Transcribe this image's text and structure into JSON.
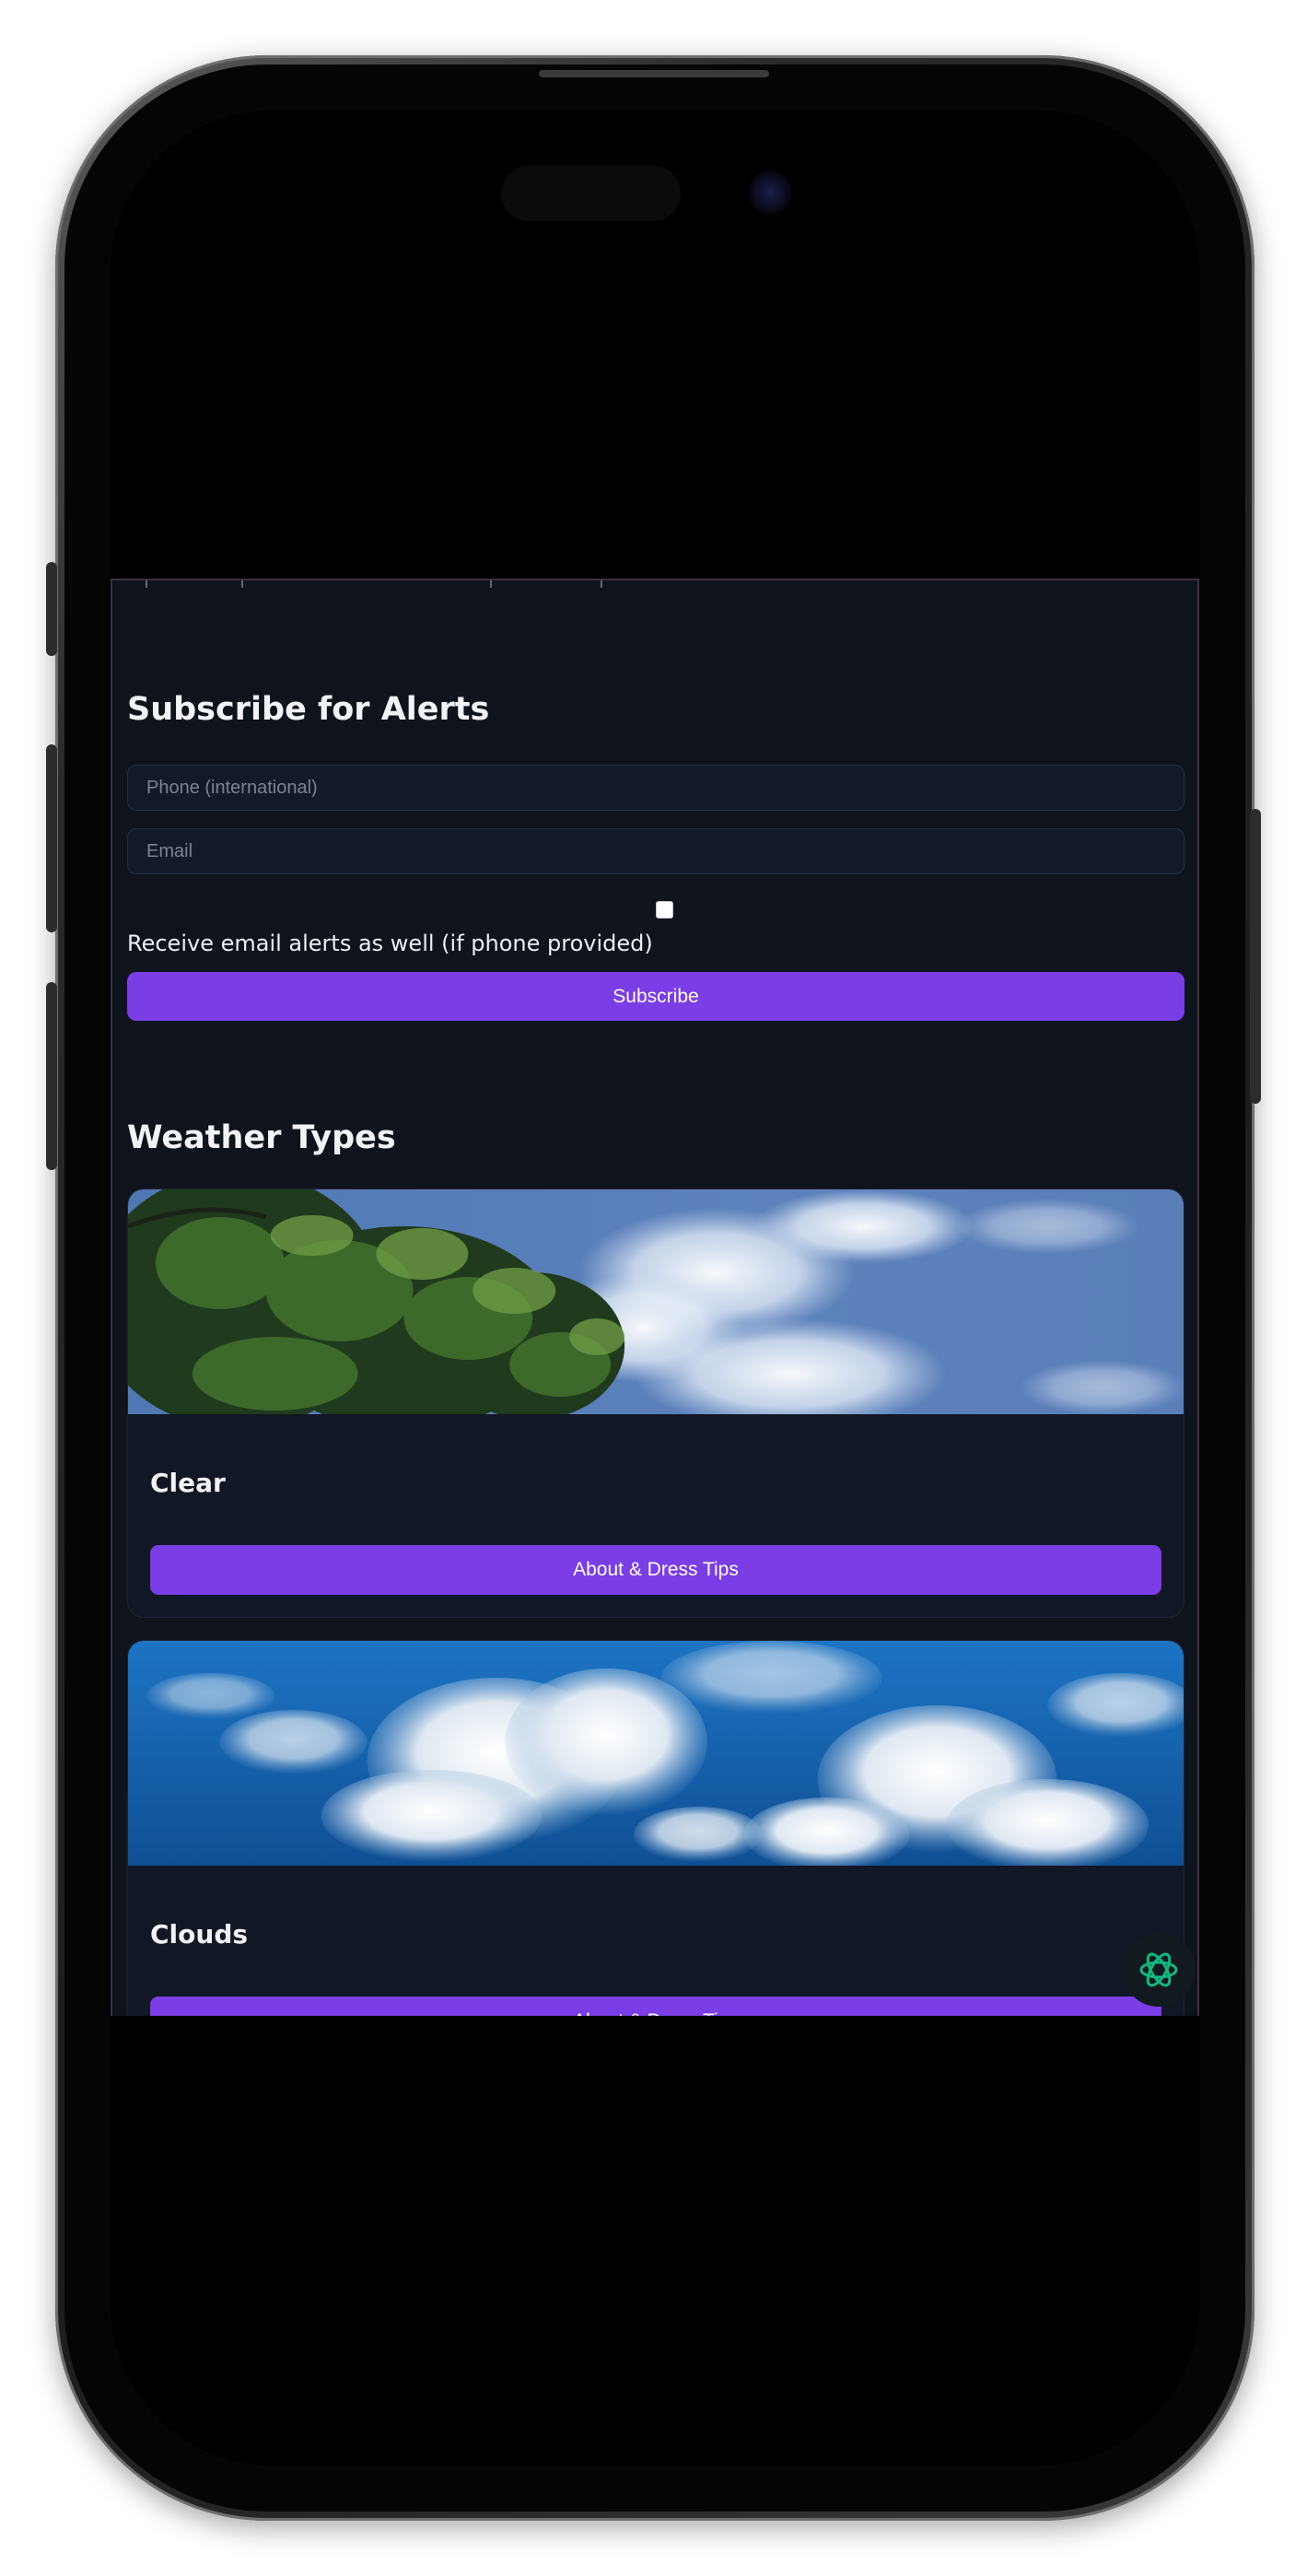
{
  "subscribe": {
    "title": "Subscribe for Alerts",
    "phone_placeholder": "Phone (international)",
    "email_placeholder": "Email",
    "checkbox_label": "Receive email alerts as well (if phone provided)",
    "submit_label": "Subscribe"
  },
  "weather_types": {
    "title": "Weather Types",
    "cards": [
      {
        "name": "Clear",
        "button_label": "About & Dress Tips"
      },
      {
        "name": "Clouds",
        "button_label": "About & Dress Tips"
      }
    ]
  },
  "colors": {
    "background": "#0f131c",
    "accent": "#7a3de6",
    "card": "#111724",
    "text": "#f2f3f7"
  },
  "icons": {
    "fab": "assistant-knot-icon"
  }
}
